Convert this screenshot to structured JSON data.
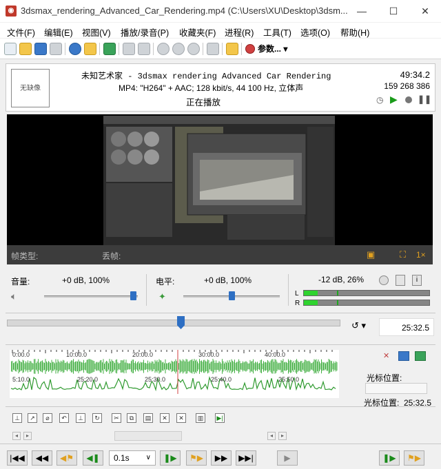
{
  "window": {
    "title": "3dsmax_rendering_Advanced_Car_Rendering.mp4 (C:\\Users\\XU\\Desktop\\3dsm...",
    "minimize": "—",
    "maximize": "☐",
    "close": "✕"
  },
  "menu": [
    "文件(F)",
    "编辑(E)",
    "视图(V)",
    "播放/录音(P)",
    "收藏夹(F)",
    "进程(R)",
    "工具(T)",
    "选项(O)",
    "帮助(H)"
  ],
  "toolbar": {
    "params_label": "参数..."
  },
  "info": {
    "avatar_text": "无缺像",
    "title_line": "未知艺术家 - 3dsmax rendering Advanced Car Rendering",
    "format_line": "MP4: \"H264\" + AAC; 128 kbit/s, 44 100 Hz, 立体声",
    "status": "正在播放",
    "duration": "49:34.2",
    "size": "159 268 386"
  },
  "framebar": {
    "frame_type": "帧类型:",
    "dropped": "丢帧:",
    "speed": "1×"
  },
  "volume": {
    "label": "音量:",
    "value": "+0 dB, 100%",
    "level": 0.95
  },
  "pan": {
    "label": "电平:",
    "value": "+0 dB, 100%",
    "level": 0.5
  },
  "meter": {
    "value": "-12 dB, 26%",
    "left_label": "L",
    "right_label": "R",
    "level": 0.26
  },
  "position": {
    "time": "25:32.5",
    "fraction": 0.515
  },
  "waveform": {
    "top_ticks": [
      "0:00.0",
      "10:00.0",
      "20:00.0",
      "30:00.0",
      "40:00.0"
    ],
    "bottom_ticks": [
      "5:10.0",
      "25:20.0",
      "25:30.0",
      "25:40.0",
      "25:50.0"
    ]
  },
  "cursor": {
    "label": "光标位置:",
    "label2": "光标位置:",
    "value": "25:32.5"
  },
  "bottom": {
    "step": "0.1s"
  }
}
